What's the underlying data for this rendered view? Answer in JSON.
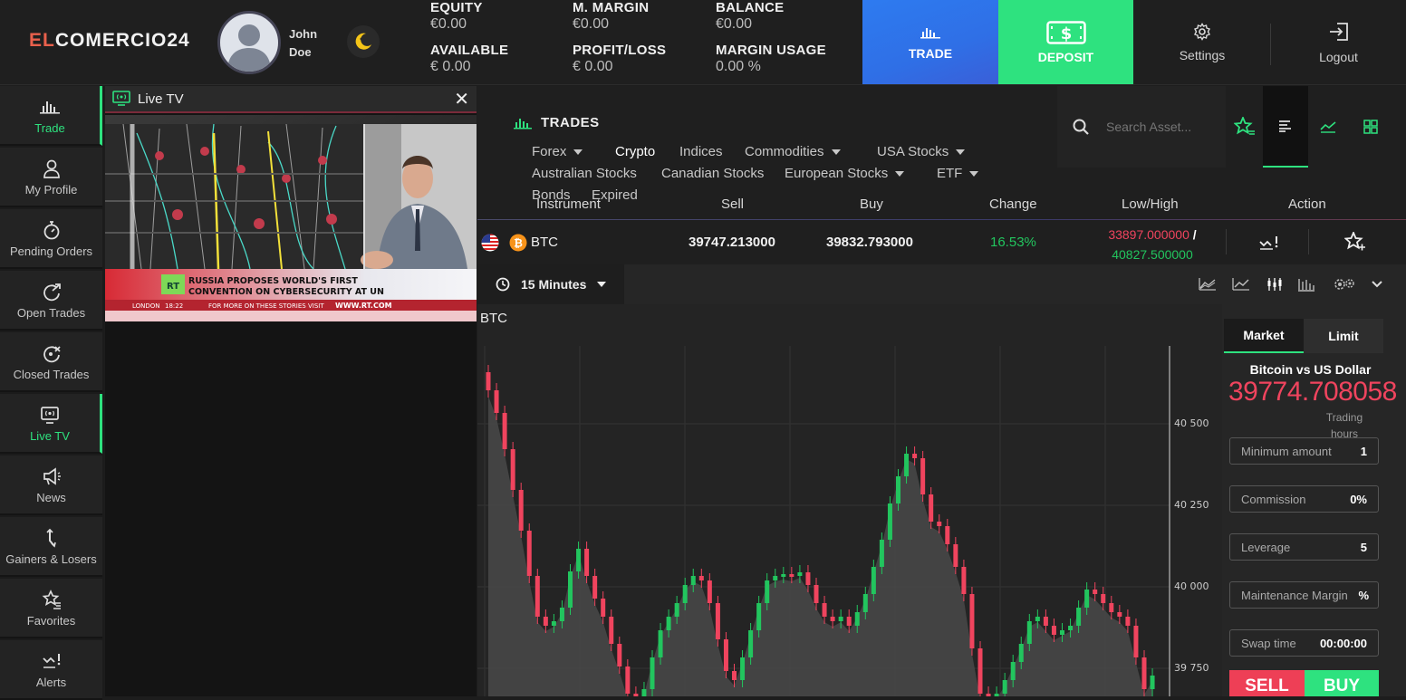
{
  "header": {
    "logo_prefix": "EL",
    "logo_rest": "COMERCIO24",
    "user_first": "John",
    "user_last": "Doe",
    "stats": {
      "equity_label": "EQUITY",
      "equity_value": "€0.00",
      "margin_label": "M. MARGIN",
      "margin_value": "€0.00",
      "balance_label": "BALANCE",
      "balance_value": "€0.00",
      "available_label": "AVAILABLE",
      "available_value": "€ 0.00",
      "pl_label": "PROFIT/LOSS",
      "pl_value": "€ 0.00",
      "mu_label": "MARGIN USAGE",
      "mu_value": "0.00 %"
    },
    "trade_label": "TRADE",
    "deposit_label": "DEPOSIT",
    "settings_label": "Settings",
    "logout_label": "Logout"
  },
  "sidebar": {
    "items": [
      {
        "label": "Trade",
        "icon": "chart-bars-icon"
      },
      {
        "label": "My Profile",
        "icon": "user-icon"
      },
      {
        "label": "Pending Orders",
        "icon": "stopwatch-icon"
      },
      {
        "label": "Open Trades",
        "icon": "open-trades-icon"
      },
      {
        "label": "Closed Trades",
        "icon": "closed-trades-icon"
      },
      {
        "label": "Live TV",
        "icon": "tv-icon"
      },
      {
        "label": "News",
        "icon": "megaphone-icon"
      },
      {
        "label": "Gainers & Losers",
        "icon": "arrows-icon"
      },
      {
        "label": "Favorites",
        "icon": "star-list-icon"
      },
      {
        "label": "Alerts",
        "icon": "alert-icon"
      }
    ]
  },
  "livetv": {
    "title": "Live TV",
    "close": "✕",
    "headline1": "RUSSIA PROPOSES WORLD'S FIRST",
    "headline2": "CONVENTION ON CYBERSECURITY AT UN",
    "ticker_city": "LONDON",
    "ticker_time": "18:22",
    "ticker_text": "FOR MORE ON THESE STORIES VISIT",
    "ticker_site": "WWW.RT.COM",
    "channel_logo": "RT"
  },
  "trades": {
    "title": "TRADES",
    "categories": [
      "Forex",
      "Crypto",
      "Indices",
      "Commodities",
      "USA Stocks",
      "Australian Stocks",
      "Canadian Stocks",
      "European Stocks",
      "ETF",
      "Bonds",
      "Expired"
    ],
    "search_placeholder": "Search Asset...",
    "columns": [
      "Instrument",
      "Sell",
      "Buy",
      "Change",
      "Low/High",
      "Action"
    ],
    "row": {
      "symbol": "BTC",
      "coin_glyph": "₿",
      "sell": "39747.213000",
      "buy": "39832.793000",
      "change": "16.53%",
      "low": "33897.000000",
      "slash": "/",
      "high": "40827.500000"
    }
  },
  "chart": {
    "timeframe": "15 Minutes",
    "symbol": "BTC",
    "y_ticks": [
      "40 500",
      "40 250",
      "40 000",
      "39 750"
    ]
  },
  "order": {
    "tab_market": "Market",
    "tab_limit": "Limit",
    "pair_name": "Bitcoin vs US Dollar",
    "price": "39774.708058",
    "trading_hours": "Trading hours",
    "fields": [
      {
        "label": "Minimum amount",
        "value": "1"
      },
      {
        "label": "Commission",
        "value": "0%"
      },
      {
        "label": "Leverage",
        "value": "5"
      },
      {
        "label": "Maintenance Margin",
        "value": "%"
      },
      {
        "label": "Swap time",
        "value": "00:00:00"
      }
    ],
    "sell_label": "SELL",
    "buy_label": "BUY"
  },
  "colors": {
    "accent_green": "#2ee27f",
    "trade_blue": "#2f6fe6",
    "down_red": "#f0445e",
    "up_green": "#22c55e"
  }
}
